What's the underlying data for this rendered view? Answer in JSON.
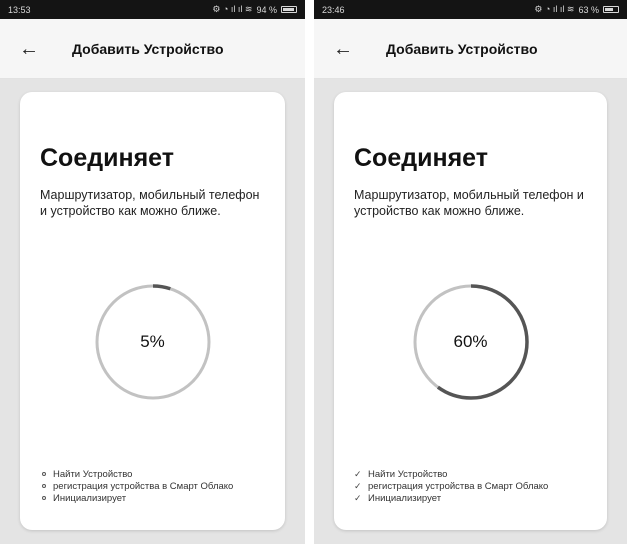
{
  "screens": [
    {
      "status": {
        "time": "13:53",
        "battery": "94 %",
        "battery_level": 0.94
      },
      "appbar": {
        "title": "Добавить Устройство"
      },
      "card": {
        "title": "Соединяет",
        "description": "Маршрутизатор, мобильный телефон и устройство как можно ближе.",
        "progress": {
          "value": 5,
          "label": "5%"
        },
        "steps": [
          {
            "label": "Найти Устройство",
            "state": "pending"
          },
          {
            "label": "регистрация устройства в Смарт Облако",
            "state": "pending"
          },
          {
            "label": "Инициализирует",
            "state": "pending"
          }
        ]
      }
    },
    {
      "status": {
        "time": "23:46",
        "battery": "63 %",
        "battery_level": 0.63
      },
      "appbar": {
        "title": "Добавить Устройство"
      },
      "card": {
        "title": "Соединяет",
        "description": "Маршрутизатор, мобильный телефон и устройство как можно ближе.",
        "progress": {
          "value": 60,
          "label": "60%"
        },
        "steps": [
          {
            "label": "Найти Устройство",
            "state": "done"
          },
          {
            "label": "регистрация устройства в Смарт Облако",
            "state": "done"
          },
          {
            "label": "Инициализирует",
            "state": "done"
          }
        ]
      }
    }
  ],
  "icons": {
    "back": "arrow-left-icon",
    "pending": "hollow-dot-icon",
    "done": "check-icon"
  },
  "colors": {
    "progress_track": "#c2c2c2",
    "progress_fill": "#555555",
    "background": "#e4e4e4",
    "card": "#ffffff"
  }
}
